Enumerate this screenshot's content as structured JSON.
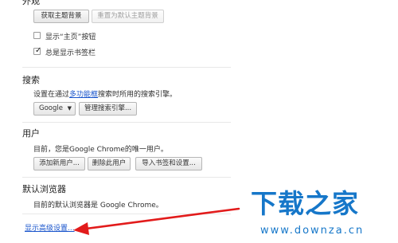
{
  "appearance": {
    "section_title": "外观",
    "get_themes_label": "获取主题背景",
    "reset_theme_label": "重置为默认主题背景",
    "show_home_label": "显示“主页”按钮",
    "show_home_checked": false,
    "bookmarks_bar_label": "总是显示书签栏",
    "bookmarks_bar_checked": true
  },
  "search": {
    "section_title": "搜索",
    "desc_prefix": "设置在通过",
    "desc_link": "多功能框",
    "desc_suffix": "搜索时所用的搜索引擎。",
    "engine_selected": "Google",
    "manage_label": "管理搜索引擎..."
  },
  "users": {
    "section_title": "用户",
    "desc": "目前，您是Google Chrome的唯一用户。",
    "add_user_label": "添加新用户...",
    "delete_user_label": "删除此用户",
    "import_label": "导入书签和设置..."
  },
  "default_browser": {
    "section_title": "默认浏览器",
    "desc": "目前的默认浏览器是 Google Chrome。"
  },
  "footer": {
    "show_advanced_label": "显示高级设置..."
  },
  "annotation": {
    "arrow_color": "#e21b1b"
  },
  "watermark": {
    "title": "下载之家",
    "url": "www.downza.cn"
  }
}
